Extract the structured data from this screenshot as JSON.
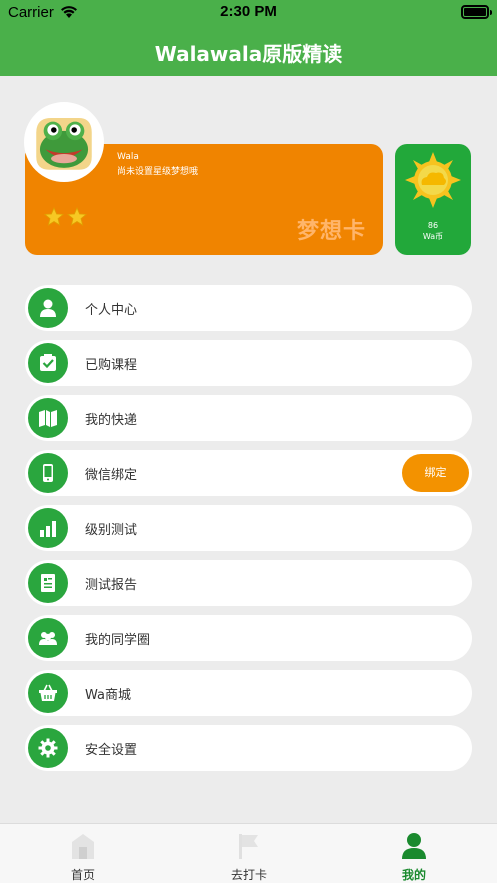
{
  "status_bar": {
    "carrier": "Carrier",
    "time": "2:30 PM"
  },
  "navbar": {
    "title": "Walawala原版精读"
  },
  "profile": {
    "name": "Wala",
    "subtitle": "尚未设置星级梦想哦",
    "card_title": "梦想卡",
    "stars": 2
  },
  "coins": {
    "value": "86",
    "label": "Wa币"
  },
  "menu": {
    "items": [
      {
        "label": "个人中心",
        "icon": "person-icon"
      },
      {
        "label": "已购课程",
        "icon": "checkbox-icon"
      },
      {
        "label": "我的快递",
        "icon": "map-icon"
      },
      {
        "label": "微信绑定",
        "icon": "phone-icon",
        "action": "绑定"
      },
      {
        "label": "级别测试",
        "icon": "bar-chart-icon"
      },
      {
        "label": "测试报告",
        "icon": "report-icon"
      },
      {
        "label": "我的同学圈",
        "icon": "group-icon"
      },
      {
        "label": "Wa商城",
        "icon": "basket-icon"
      },
      {
        "label": "安全设置",
        "icon": "gear-icon"
      }
    ]
  },
  "tabbar": {
    "tabs": [
      {
        "label": "首页",
        "icon": "home-icon"
      },
      {
        "label": "去打卡",
        "icon": "flag-icon"
      },
      {
        "label": "我的",
        "icon": "profile-icon",
        "active": true
      }
    ]
  },
  "colors": {
    "primary_green": "#4ab04a",
    "card_orange": "#f08400",
    "coin_green": "#22a83a",
    "button_orange": "#f39200"
  }
}
